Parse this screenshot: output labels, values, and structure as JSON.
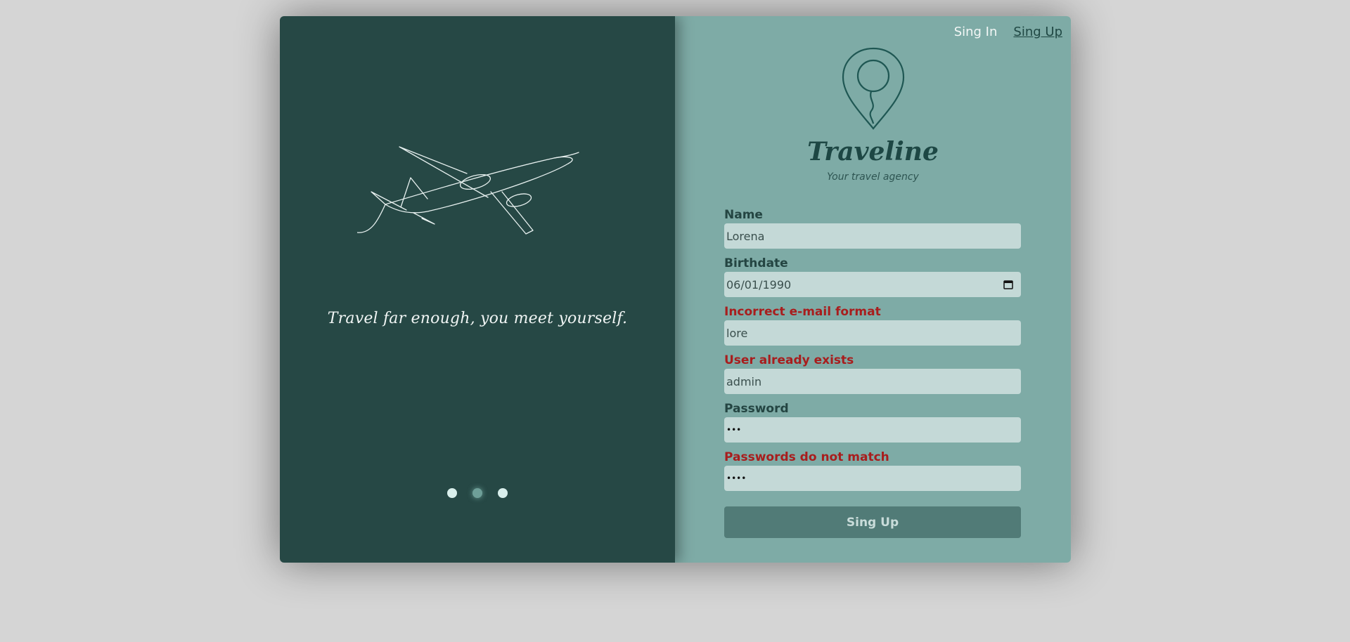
{
  "nav": {
    "sign_in": "Sing In",
    "sign_up": "Sing Up"
  },
  "brand": {
    "name": "Traveline",
    "tagline": "Your travel agency"
  },
  "hero": {
    "quote": "Travel far enough, you meet yourself.",
    "slides": 3,
    "active_slide": 2
  },
  "form": {
    "name_label": "Name",
    "name_value": "Lorena",
    "birthdate_label": "Birthdate",
    "birthdate_value": "06/01/1990",
    "email_label": "Incorrect e-mail format",
    "email_value": "lore",
    "user_label": "User already exists",
    "user_value": "admin",
    "password_label": "Password",
    "password_value": "•••",
    "confirm_label": "Passwords do not match",
    "confirm_value": "••••",
    "submit": "Sing Up"
  },
  "colors": {
    "left_panel": "#264845",
    "right_panel": "#7eaba6",
    "error": "#a81d1d",
    "input_bg": "#c4d9d7",
    "button_bg": "#517b77"
  },
  "icons": [
    "plane-illustration",
    "location-pin-icon",
    "calendar-icon"
  ]
}
